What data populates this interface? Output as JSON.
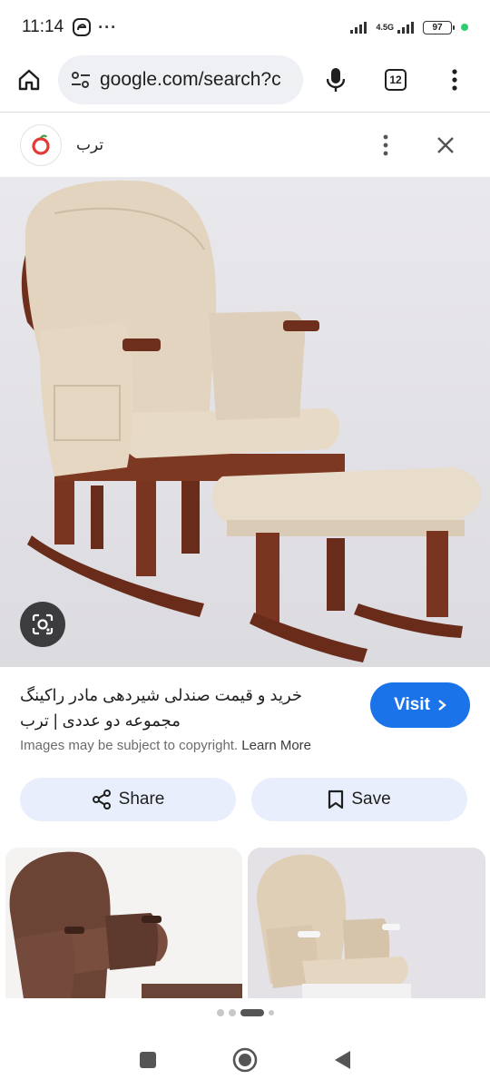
{
  "status_bar": {
    "time": "11:14",
    "network": "4.5G",
    "battery": "97",
    "more": "···"
  },
  "browser": {
    "url": "google.com/search?c",
    "tab_count": "12"
  },
  "source": {
    "name": "ترب"
  },
  "result": {
    "title": "خرید و قیمت صندلی شیردهی مادر راکینگ مجموعه دو عددی | ترب",
    "visit_label": "Visit",
    "copyright_notice": "Images may be subject to copyright.",
    "learn_more": "Learn More"
  },
  "actions": {
    "share_label": "Share",
    "save_label": "Save"
  },
  "pager": {
    "total": 4,
    "active": 2
  },
  "colors": {
    "accent": "#1a73e8",
    "pill_bg": "#e8eefb",
    "url_bg": "#eef0f3",
    "cushion": "#e2d4bf",
    "wood": "#6e2f1c"
  },
  "icons": {
    "home": "home-icon",
    "site_settings": "tune-icon",
    "mic": "mic-icon",
    "tabs": "tabs-icon",
    "menu": "more-vert-icon",
    "lens": "lens-icon",
    "share": "share-icon",
    "save": "bookmark-icon",
    "close": "close-icon"
  }
}
